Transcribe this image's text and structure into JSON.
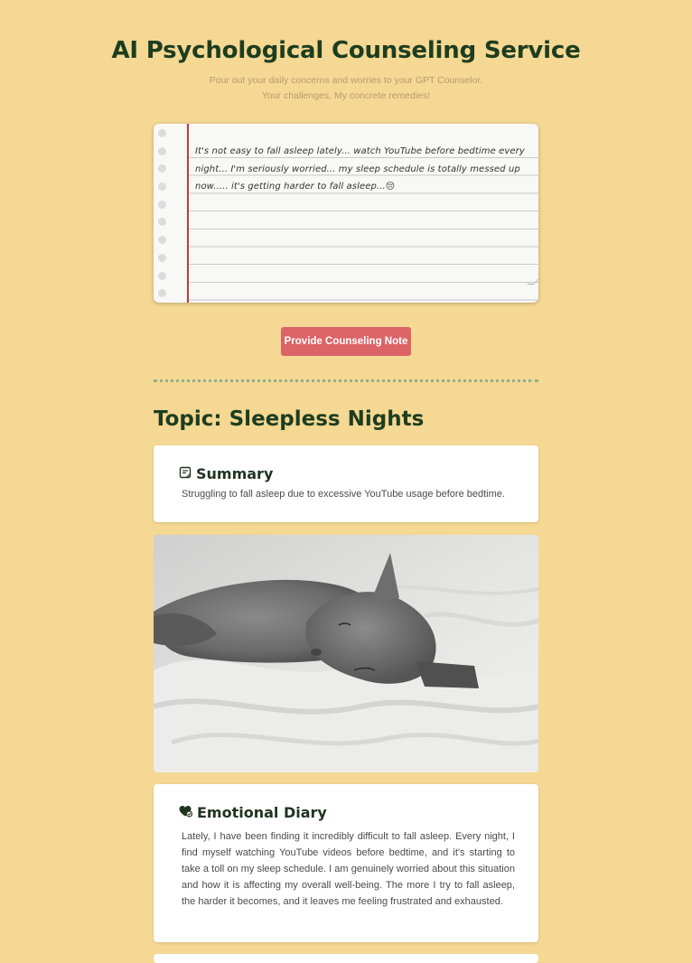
{
  "header": {
    "title": "AI Psychological Counseling Service",
    "subtitle_line1": "Pour out your daily concerns and worries to your GPT Counselor.",
    "subtitle_line2": "Your challenges, My concrete remedies!"
  },
  "input": {
    "value": "It's not easy to fall asleep lately... watch YouTube before bedtime every night... I'm seriously worried... my sleep schedule is totally messed up now..... it's getting harder to fall asleep...😔"
  },
  "actions": {
    "submit_label": "Provide Counseling Note"
  },
  "result": {
    "topic": "Topic: Sleepless Nights",
    "summary": {
      "icon": "note-icon",
      "title": "Summary",
      "text": "Struggling to fall asleep due to excessive YouTube usage before bedtime."
    },
    "image": {
      "subject": "grey cat sleeping on white bedding"
    },
    "diary": {
      "icon": "heart-icon",
      "title": "Emotional Diary",
      "text": "Lately, I have been finding it incredibly difficult to fall asleep. Every night, I find myself watching YouTube videos before bedtime, and it's starting to take a toll on my sleep schedule. I am genuinely worried about this situation and how it is affecting my overall well-being. The more I try to fall asleep, the harder it becomes, and it leaves me feeling frustrated and exhausted."
    }
  },
  "colors": {
    "background": "#f4d893",
    "title": "#1e3d1f",
    "button": "#dc6468",
    "margin_line": "#c63a3a",
    "divider": "#8fb08a"
  }
}
